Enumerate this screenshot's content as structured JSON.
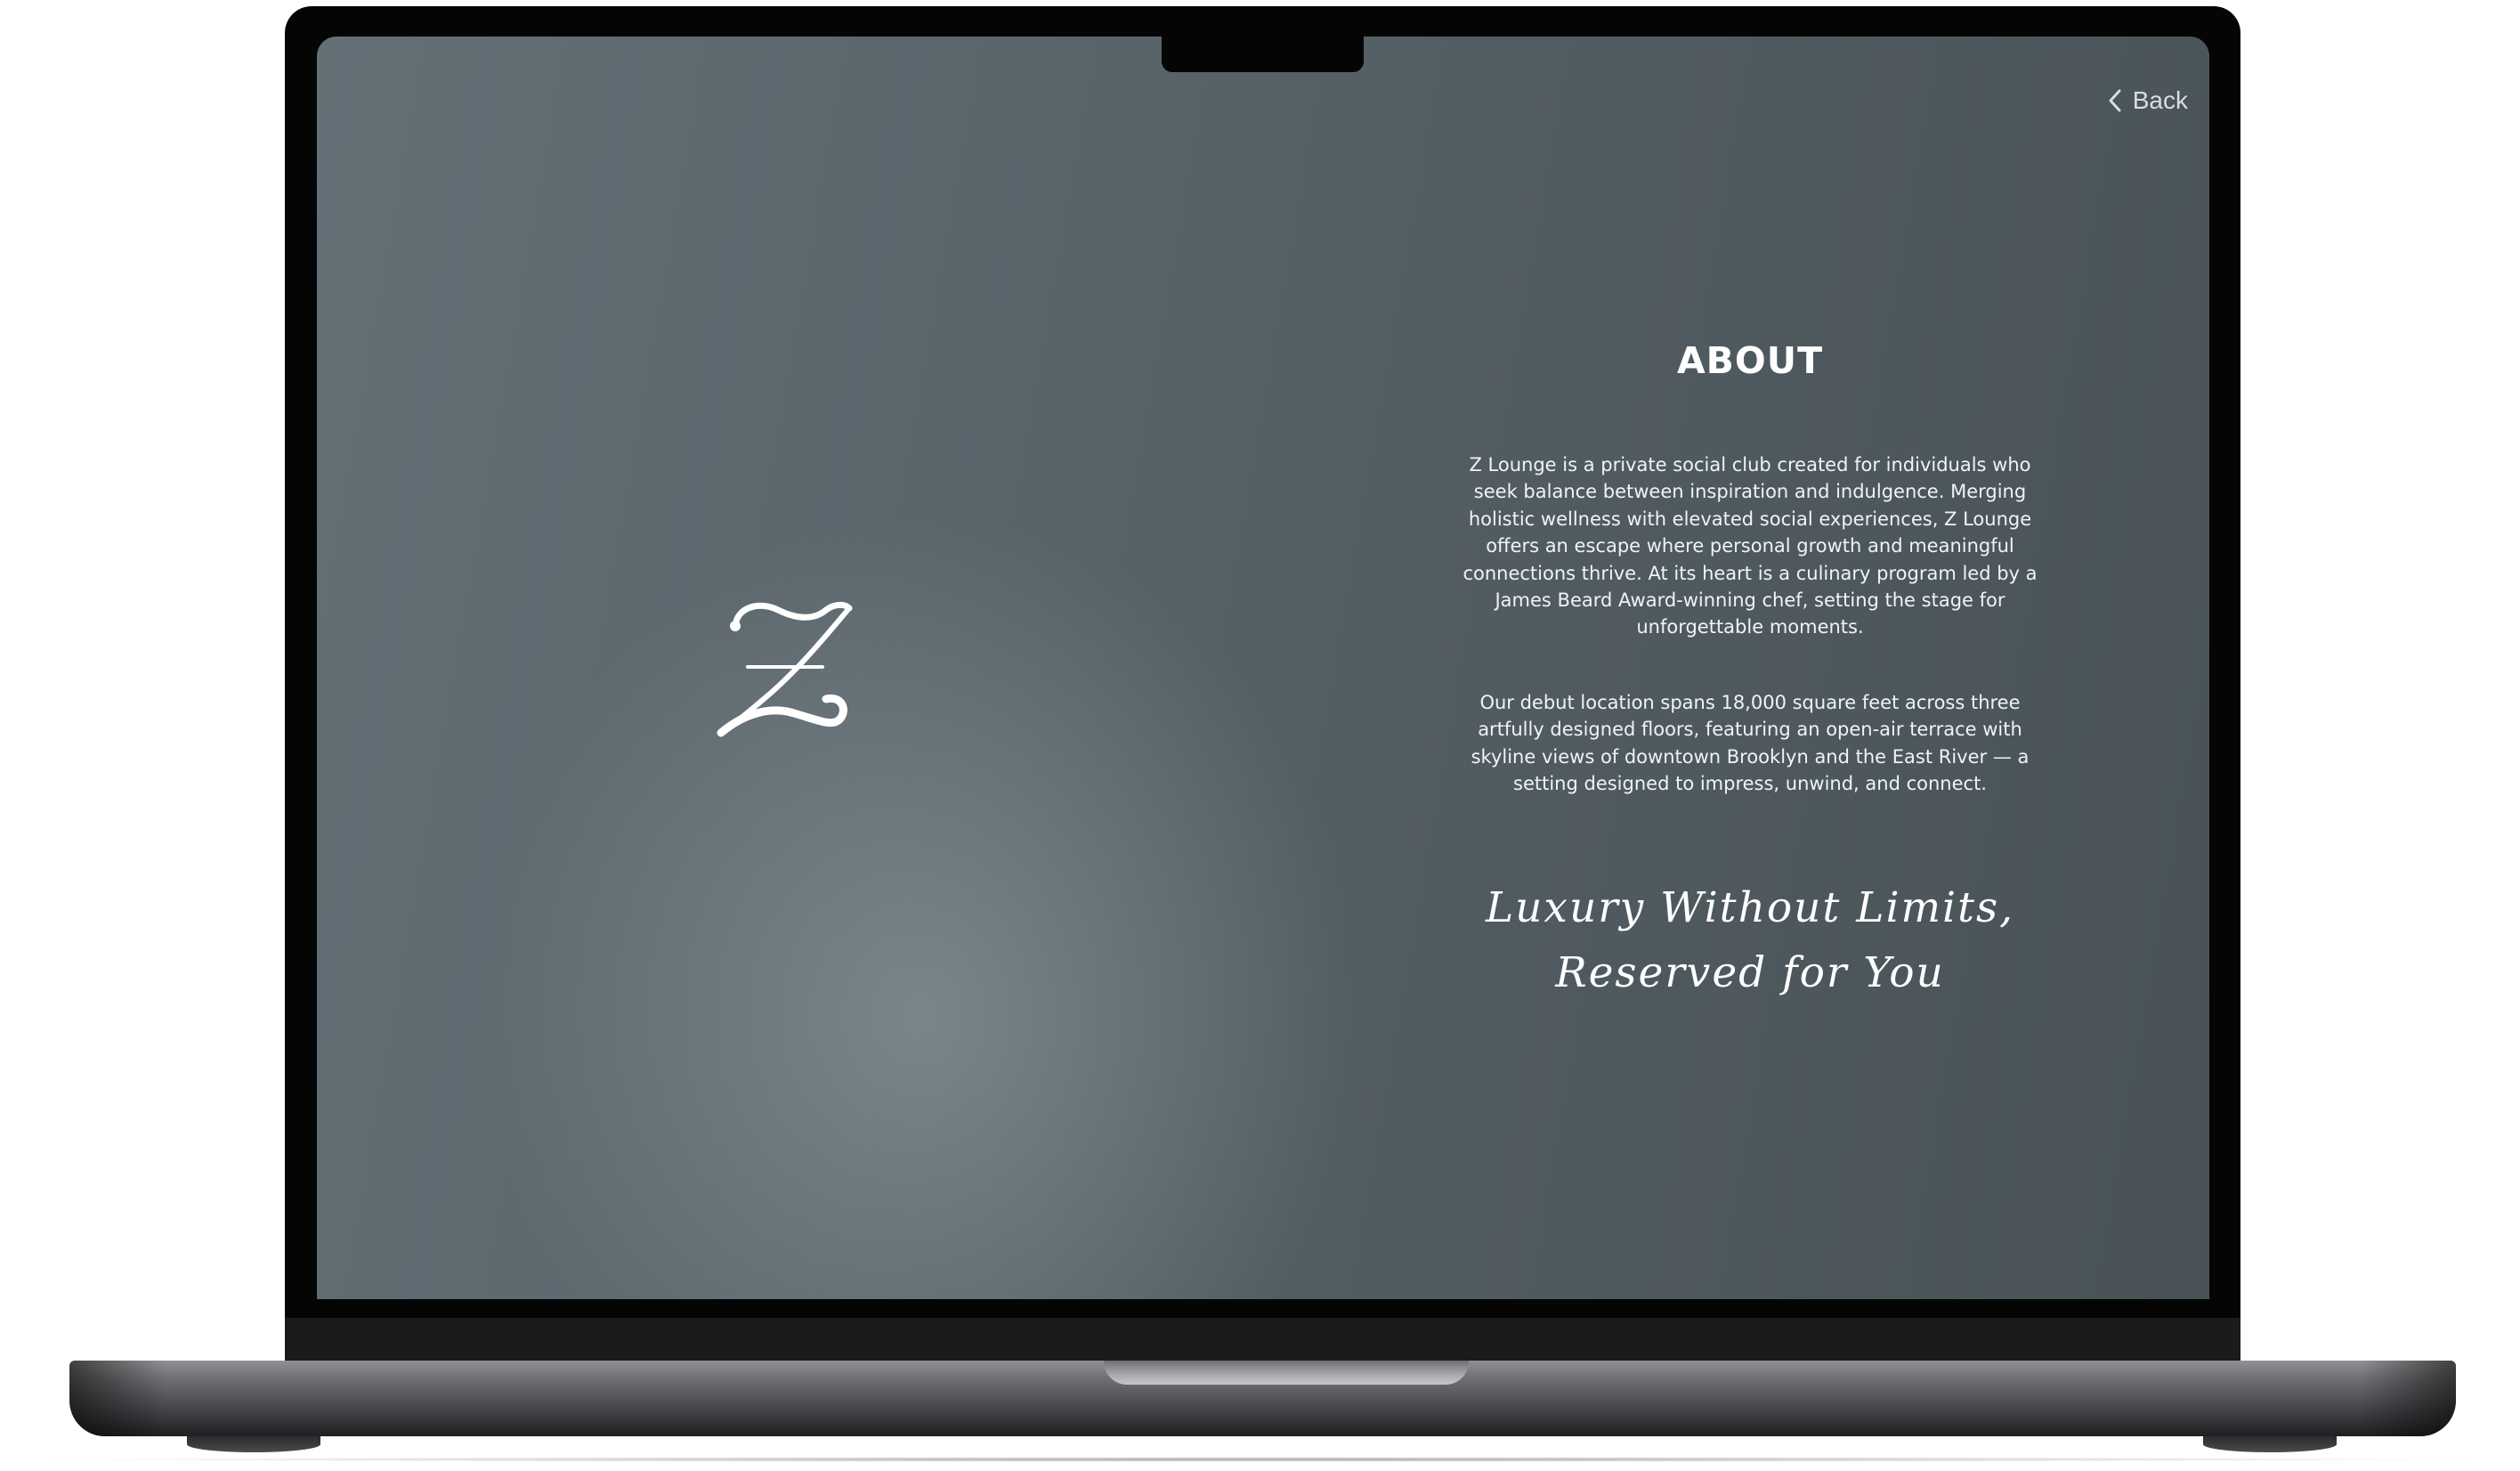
{
  "nav": {
    "back_label": "Back",
    "back_icon": "chevron-left-icon"
  },
  "logo": {
    "icon": "z-monogram-logo",
    "letter": "Z"
  },
  "about": {
    "heading": "ABOUT",
    "paragraph_1": "Z Lounge is a private social club created for individuals who seek balance between inspiration and indulgence. Merging holistic wellness with elevated social experiences, Z Lounge offers an escape where personal growth and meaningful connections thrive. At its heart is a culinary program led by a James Beard Award-winning chef, setting the stage for unforgettable moments.",
    "paragraph_2": "Our debut location spans 18,000 square feet across three artfully designed floors, featuring an open-air terrace with skyline views of downtown Brooklyn and the East River — a setting designed to impress, unwind, and connect.",
    "tagline_line_1": "Luxury Without Limits,",
    "tagline_line_2": "Reserved for You"
  },
  "colors": {
    "screen_bg_dark": "#485257",
    "screen_bg_light": "#646f76",
    "text": "#ffffff"
  }
}
